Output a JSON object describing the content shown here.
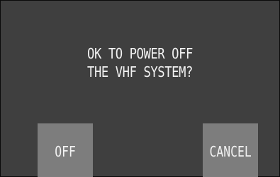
{
  "dialog": {
    "message_lines": [
      "OK TO POWER OFF",
      "THE VHF SYSTEM?"
    ],
    "buttons": {
      "off_label": "OFF",
      "cancel_label": "CANCEL"
    }
  },
  "colors": {
    "dialog_background": "#3f3f3f",
    "button_background": "#7d7d7d",
    "text": "#f2f2f2"
  }
}
